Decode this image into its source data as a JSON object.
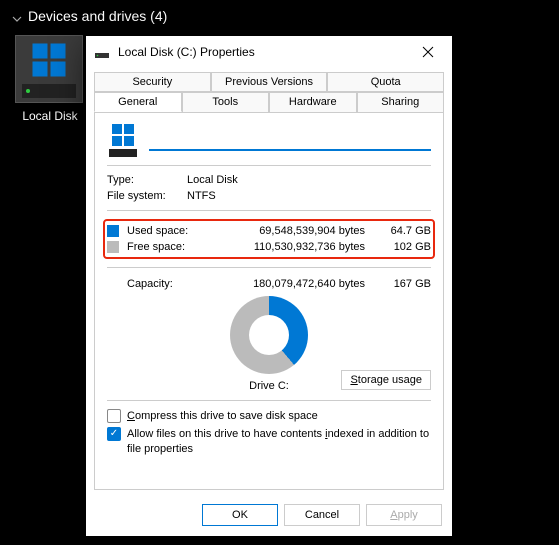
{
  "explorer": {
    "section_title": "Devices and drives (4)",
    "drive_label": "Local Disk"
  },
  "dialog": {
    "title": "Local Disk (C:) Properties",
    "tabs_row1": [
      "Security",
      "Previous Versions",
      "Quota"
    ],
    "tabs_row2": [
      "General",
      "Tools",
      "Hardware",
      "Sharing"
    ],
    "active_tab": "General",
    "name_value": "",
    "type_label": "Type:",
    "type_value": "Local Disk",
    "fs_label": "File system:",
    "fs_value": "NTFS",
    "used_label": "Used space:",
    "used_bytes": "69,548,539,904 bytes",
    "used_gb": "64.7 GB",
    "free_label": "Free space:",
    "free_bytes": "110,530,932,736 bytes",
    "free_gb": "102 GB",
    "capacity_label": "Capacity:",
    "capacity_bytes": "180,079,472,640 bytes",
    "capacity_gb": "167 GB",
    "drive_caption": "Drive C:",
    "storage_btn_pre": "S",
    "storage_btn_post": "torage usage",
    "compress_pre": "C",
    "compress_post": "ompress this drive to save disk space",
    "index_pre": "Allow files on this drive to have contents ",
    "index_u": "i",
    "index_post": "ndexed in addition to file properties",
    "ok": "OK",
    "cancel": "Cancel",
    "apply_pre": "A",
    "apply_post": "pply"
  },
  "chart_data": {
    "type": "pie",
    "title": "Drive C:",
    "series": [
      {
        "name": "Used space",
        "value": 69548539904,
        "display": "64.7 GB",
        "color": "#0078d4"
      },
      {
        "name": "Free space",
        "value": 110530932736,
        "display": "102 GB",
        "color": "#bbbbbb"
      }
    ],
    "total": {
      "name": "Capacity",
      "value": 180079472640,
      "display": "167 GB"
    }
  }
}
